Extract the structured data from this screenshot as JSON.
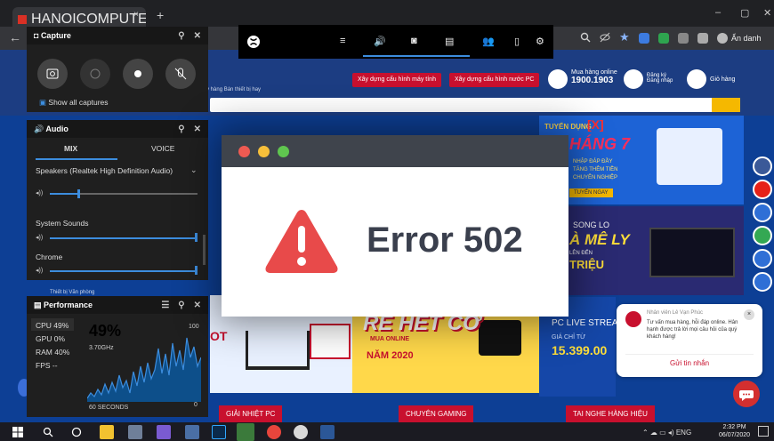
{
  "browser": {
    "tab_title": "HANOICOMPUTER - HI-END CO",
    "tab_close": "×",
    "new_tab": "+",
    "win_min": "–",
    "win_max": "▢",
    "win_close": "✕",
    "back": "←",
    "profile_label": "Ẩn danh"
  },
  "site": {
    "header_buttons": [
      "Xây dựng cấu hình máy tính",
      "Xây dựng cấu hình nước PC"
    ],
    "hotline_label": "Mua hàng online",
    "hotline_number": "1900.1903",
    "account_label": "Đăng ký Đăng nhập",
    "cart_label": "Giỏ hàng",
    "top_cats": "Bán chạy hàng   Bán thiết bị hay",
    "promo_tuyen": "TUYỂN DỤNG",
    "promo_x": "[X]",
    "promo_thang": "HÁNG 7",
    "promo_lines": [
      "NHẬP ĐÁP ĐẦY",
      "TĂNG THÊM TIỀN",
      "CHUYÊN NGHIỆP"
    ],
    "promo_button": "TUYỂN NGAY",
    "songlo": "SONG LO",
    "ame_ly": "À MÊ LY",
    "len_den": "LÊN ĐẾN",
    "trieu": "TRIỆU",
    "rehet": "RẺ HẾT CỠ",
    "nam_sub": "MUA ONLINE",
    "nam_2020": "NĂM 2020",
    "ot": "OT",
    "pc_live": "PC LIVE STREA",
    "gia_chi_tu": "GIÁ CHỈ TỪ",
    "price": "15.399.00",
    "bottom_buttons": [
      "GIẢI NHIỆT PC",
      "CHUYÊN GAMING",
      "TAI NGHE HÀNG HIỆU"
    ],
    "left_text": "Thiết bị Văn phòng"
  },
  "chat": {
    "agent_name": "Nhân viên Lê Vạn Phúc",
    "message": "Tư vấn mua hàng, hỗi đáp online. Hân hạnh được trả lời mọi câu hỏi của quý khách hàng!",
    "close": "×",
    "send_label": "Gửi tin nhắn"
  },
  "gamebar": {
    "time": "2:32 PM",
    "icons": [
      "menu-icon",
      "audio-icon",
      "capture-icon",
      "performance-icon",
      "social-icon",
      "mouse-icon",
      "settings-icon"
    ]
  },
  "capture": {
    "title": "Capture",
    "show_all": "Show all captures"
  },
  "audio": {
    "title": "Audio",
    "tab_mix": "MIX",
    "tab_voice": "VOICE",
    "device": "Speakers (Realtek High Definition Audio)",
    "channels": [
      {
        "label": "System Sounds",
        "volume": 1.0
      },
      {
        "label": "Chrome",
        "volume": 1.0
      }
    ],
    "master_volume": 0.19
  },
  "performance": {
    "title": "Performance",
    "cpu": "CPU  49%",
    "gpu": "GPU  0%",
    "ram": "RAM  40%",
    "fps": "FPS  --",
    "big_value": "49%",
    "freq": "3.70GHz",
    "max_label": "100",
    "min_label": "0",
    "time_label": "60 SECONDS"
  },
  "error": {
    "message": "Error 502",
    "dot_colors": [
      "#ee5a52",
      "#f6bf3a",
      "#5fc64f"
    ],
    "accent": "#e84a4a"
  },
  "taskbar": {
    "lang": "ENG",
    "time": "2:32 PM",
    "date": "06/07/2020"
  }
}
